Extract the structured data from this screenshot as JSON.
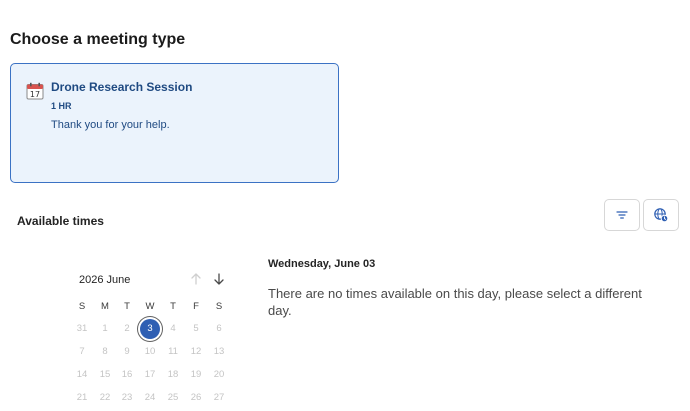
{
  "page": {
    "heading": "Choose a meeting type"
  },
  "meeting_card": {
    "icon": "calendar-icon",
    "title": "Drone Research Session",
    "duration": "1 HR",
    "description": "Thank you for your help."
  },
  "availability": {
    "label": "Available times",
    "filter_icon": "filter-icon",
    "timezone_icon": "globe-icon"
  },
  "calendar": {
    "month_label": "2026 June",
    "prev_icon": "arrow-up-icon",
    "next_icon": "arrow-down-icon",
    "weekdays": [
      "S",
      "M",
      "T",
      "W",
      "T",
      "F",
      "S"
    ],
    "weeks": [
      [
        "31",
        "1",
        "2",
        "3",
        "4",
        "5",
        "6"
      ],
      [
        "7",
        "8",
        "9",
        "10",
        "11",
        "12",
        "13"
      ],
      [
        "14",
        "15",
        "16",
        "17",
        "18",
        "19",
        "20"
      ],
      [
        "21",
        "22",
        "23",
        "24",
        "25",
        "26",
        "27"
      ]
    ],
    "selected_day": "3"
  },
  "day_panel": {
    "date_title": "Wednesday, June 03",
    "message": "There are no times available on this day, please select a different day."
  },
  "colors": {
    "accent": "#2f5fb3",
    "card_background": "#ebf3fc",
    "card_border": "#3b72c4",
    "disabled_text": "#c4c4c4"
  }
}
